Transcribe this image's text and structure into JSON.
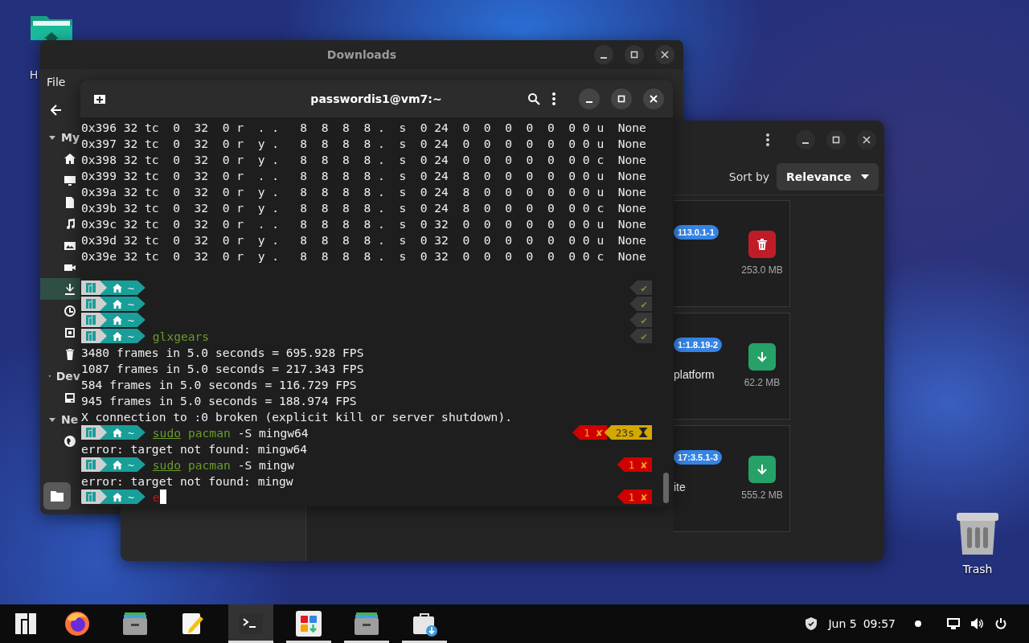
{
  "desktop": {
    "icons": [
      {
        "kind": "home-folder",
        "label": "H"
      },
      {
        "kind": "trash",
        "label": "Trash"
      }
    ]
  },
  "files_window": {
    "title": "Downloads",
    "menu": [
      "File"
    ],
    "sidebar": [
      {
        "label": "My",
        "expanded": true,
        "items": [
          {
            "kind": "home",
            "selected": false
          },
          {
            "kind": "desktop",
            "selected": false
          },
          {
            "kind": "document",
            "selected": false
          },
          {
            "kind": "music",
            "selected": false
          },
          {
            "kind": "picture",
            "selected": false
          },
          {
            "kind": "video",
            "selected": false
          },
          {
            "kind": "download",
            "selected": true
          },
          {
            "kind": "recent",
            "selected": false
          },
          {
            "kind": "screenshot",
            "selected": false
          },
          {
            "kind": "trash",
            "selected": false
          }
        ]
      },
      {
        "label": "Dev",
        "expanded": true,
        "items": [
          {
            "kind": "drive",
            "selected": false
          }
        ]
      },
      {
        "label": "Ne",
        "expanded": true,
        "items": [
          {
            "kind": "network",
            "selected": false
          }
        ]
      }
    ]
  },
  "software_window": {
    "sort_label": "Sort by",
    "sort_value": "Relevance",
    "cards": [
      {
        "version": "113.0.1-1",
        "kind": "installed",
        "size": "253.0 MB"
      },
      {
        "version": "1:1.8.19-2",
        "name": "platform",
        "kind": "available",
        "size": "62.2 MB"
      },
      {
        "version": "17:3.5.1-3",
        "name": "ite",
        "kind": "available",
        "size": "555.2 MB"
      }
    ]
  },
  "terminal": {
    "title": "passwordis1@vm7:~",
    "lines": [
      {
        "kind": "output",
        "text": "0x396 32 tc  0  32  0 r  . .   8  8  8  8 .  s  0 24  0  0  0  0  0  0 0 u  None"
      },
      {
        "kind": "output",
        "text": "0x397 32 tc  0  32  0 r  y .   8  8  8  8 .  s  0 24  0  0  0  0  0  0 0 u  None"
      },
      {
        "kind": "output",
        "text": "0x398 32 tc  0  32  0 r  y .   8  8  8  8 .  s  0 24  0  0  0  0  0  0 0 c  None"
      },
      {
        "kind": "output",
        "text": "0x399 32 tc  0  32  0 r  . .   8  8  8  8 .  s  0 24  8  0  0  0  0  0 0 u  None"
      },
      {
        "kind": "output",
        "text": "0x39a 32 tc  0  32  0 r  y .   8  8  8  8 .  s  0 24  8  0  0  0  0  0 0 u  None"
      },
      {
        "kind": "output",
        "text": "0x39b 32 tc  0  32  0 r  y .   8  8  8  8 .  s  0 24  8  0  0  0  0  0 0 c  None"
      },
      {
        "kind": "output",
        "text": "0x39c 32 tc  0  32  0 r  . .   8  8  8  8 .  s  0 32  0  0  0  0  0  0 0 u  None"
      },
      {
        "kind": "output",
        "text": "0x39d 32 tc  0  32  0 r  y .   8  8  8  8 .  s  0 32  0  0  0  0  0  0 0 u  None"
      },
      {
        "kind": "output",
        "text": "0x39e 32 tc  0  32  0 r  y .   8  8  8  8 .  s  0 32  0  0  0  0  0  0 0 c  None"
      },
      {
        "kind": "blank"
      },
      {
        "kind": "prompt",
        "dir": "~",
        "status": [
          {
            "kind": "ok",
            "text": "✔"
          }
        ]
      },
      {
        "kind": "prompt",
        "dir": "~",
        "status": [
          {
            "kind": "ok",
            "text": "✔"
          }
        ]
      },
      {
        "kind": "prompt",
        "dir": "~",
        "status": [
          {
            "kind": "ok",
            "text": "✔"
          }
        ]
      },
      {
        "kind": "prompt",
        "dir": "~",
        "command": [
          {
            "text": "glxgears",
            "kind": "command"
          }
        ],
        "status": [
          {
            "kind": "ok",
            "text": "✔"
          }
        ]
      },
      {
        "kind": "output",
        "text": "3480 frames in 5.0 seconds = 695.928 FPS"
      },
      {
        "kind": "output",
        "text": "1087 frames in 5.0 seconds = 217.343 FPS"
      },
      {
        "kind": "output",
        "text": "584 frames in 5.0 seconds = 116.729 FPS"
      },
      {
        "kind": "output",
        "text": "945 frames in 5.0 seconds = 188.974 FPS"
      },
      {
        "kind": "output",
        "text": "X connection to :0 broken (explicit kill or server shutdown)."
      },
      {
        "kind": "prompt",
        "dir": "~",
        "command": [
          {
            "text": "sudo",
            "kind": "prefix"
          },
          {
            "text": "pacman",
            "kind": "command"
          },
          {
            "text": "-S mingw64",
            "kind": "argument"
          }
        ],
        "status": [
          {
            "kind": "error",
            "text": "1 ✘"
          },
          {
            "kind": "duration",
            "text": "23s"
          }
        ]
      },
      {
        "kind": "output",
        "text": "error: target not found: mingw64"
      },
      {
        "kind": "prompt",
        "dir": "~",
        "command": [
          {
            "text": "sudo",
            "kind": "prefix"
          },
          {
            "text": "pacman",
            "kind": "command"
          },
          {
            "text": "-S mingw",
            "kind": "argument"
          }
        ],
        "status": [
          {
            "kind": "error",
            "text": "1 ✘"
          }
        ]
      },
      {
        "kind": "output",
        "text": "error: target not found: mingw"
      },
      {
        "kind": "prompt",
        "dir": "~",
        "command": [
          {
            "text": "e",
            "kind": "unknown"
          }
        ],
        "cursor": true,
        "status": [
          {
            "kind": "error",
            "text": "1 ✘"
          }
        ]
      }
    ]
  },
  "taskbar": {
    "apps": [
      {
        "kind": "menu",
        "running": false,
        "active": false
      },
      {
        "kind": "browser",
        "running": false,
        "active": false
      },
      {
        "kind": "files",
        "running": false,
        "active": false
      },
      {
        "kind": "editor",
        "running": false,
        "active": false
      },
      {
        "kind": "terminal",
        "running": true,
        "active": true
      },
      {
        "kind": "software",
        "running": true,
        "active": false
      },
      {
        "kind": "files",
        "running": true,
        "active": false
      },
      {
        "kind": "store",
        "running": true,
        "active": false
      }
    ],
    "date": "Jun 5",
    "time": "09:57"
  }
}
